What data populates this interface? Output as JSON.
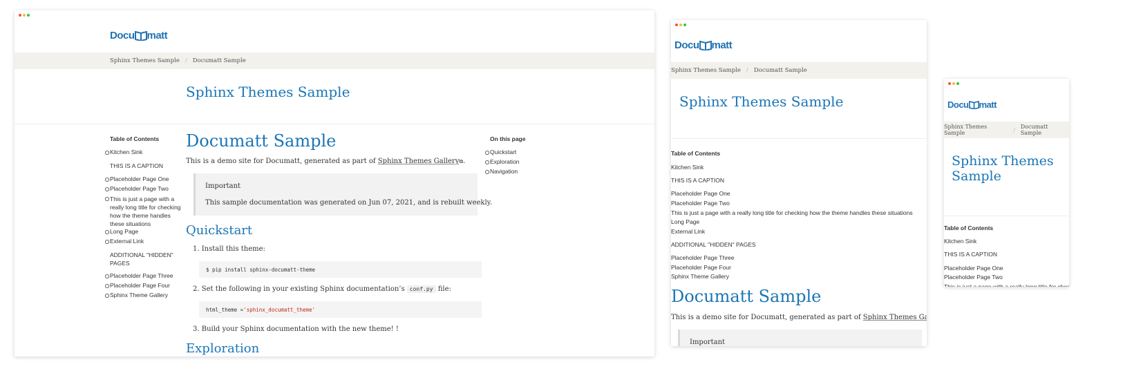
{
  "brand": {
    "name_pre": "Docu",
    "name_post": "matt",
    "accent": "#1a75b6",
    "logo_icon": "open-book-icon"
  },
  "breadcrumbs": [
    "Sphinx Themes Sample",
    "Documatt Sample"
  ],
  "site_title": "Sphinx Themes Sample",
  "toc": {
    "heading": "Table of Contents",
    "kitchen_sink": "Kitchen Sink",
    "caption1": "THIS IS A CAPTION",
    "items1": [
      "Placeholder Page One",
      "Placeholder Page Two"
    ],
    "long_title": "This is just a page with a really long title for checking how the theme handles these situations",
    "long_title_lines": [
      "This is just a page with a",
      "really long title for checking",
      "how the theme handles",
      "these situations"
    ],
    "items2": [
      "Long Page",
      "External Link"
    ],
    "caption2": "ADDITIONAL \"HIDDEN\" PAGES",
    "caption2_lines": [
      "ADDITIONAL \"HIDDEN\"",
      "PAGES"
    ],
    "items3": [
      "Placeholder Page Three",
      "Placeholder Page Four",
      "Sphinx Theme Gallery"
    ]
  },
  "on_this_page": {
    "heading": "On this page",
    "items": [
      "Quickstart",
      "Exploration",
      "Navigation"
    ]
  },
  "content": {
    "h1": "Documatt Sample",
    "intro_pre": "This is a demo site for Documatt, generated as part of ",
    "intro_link": "Sphinx Themes Gallery",
    "intro_post": ".",
    "admonition_title": "Important",
    "admonition_body": "This sample documentation was generated on Jun 07, 2021, and is rebuilt weekly.",
    "h2_quickstart": "Quickstart",
    "step1": "Install this theme:",
    "code1": "$ pip install sphinx-documatt-theme",
    "step2_pre": "Set the following in your existing Sphinx documentation’s",
    "step2_code": "conf.py",
    "step2_post": "file:",
    "code2_pre": "html_theme = ",
    "code2_str": "'sphinx_documatt_theme'",
    "step3": "Build your Sphinx documentation with the new theme! !",
    "h2_exploration": "Exploration",
    "sample_title_lines": [
      "Sphinx Themes",
      "Sample"
    ]
  }
}
